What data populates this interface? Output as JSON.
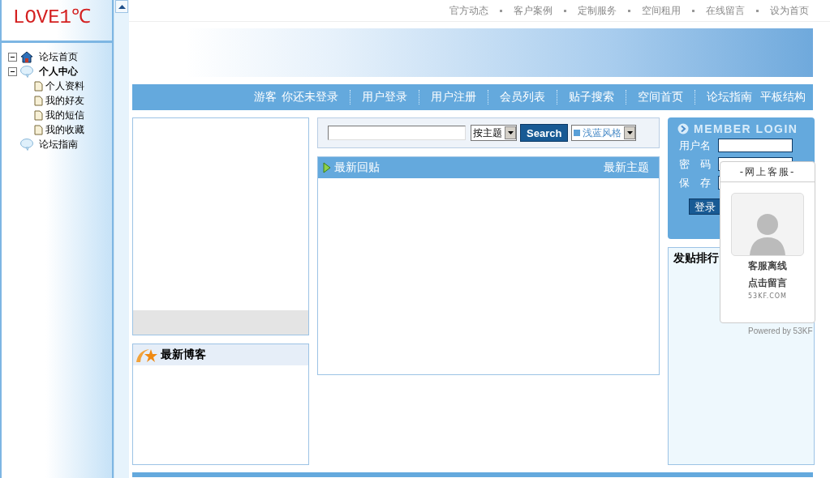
{
  "sidebar": {
    "logo": "LOVE1℃",
    "tree": [
      {
        "label": "论坛首页",
        "kind": "house",
        "bold": false,
        "expanded": true
      },
      {
        "label": "个人中心",
        "kind": "bubble",
        "bold": true,
        "expanded": true,
        "children": [
          {
            "label": "个人资料",
            "kind": "page",
            "bold": false
          },
          {
            "label": "我的好友",
            "kind": "page",
            "bold": false
          },
          {
            "label": "我的短信",
            "kind": "page",
            "bold": false
          },
          {
            "label": "我的收藏",
            "kind": "page",
            "bold": false
          }
        ]
      },
      {
        "label": "论坛指南",
        "kind": "bubble",
        "bold": false
      }
    ]
  },
  "top_links": [
    "官方动态",
    "客户案例",
    "定制服务",
    "空间租用",
    "在线留言",
    "设为首页"
  ],
  "nav": {
    "guest": "游客",
    "status": "你还未登录",
    "links": [
      {
        "label": "用户登录",
        "divider_before": true
      },
      {
        "label": "用户注册",
        "divider_before": true
      },
      {
        "label": "会员列表",
        "divider_before": true
      },
      {
        "label": "贴子搜索",
        "divider_before": true
      },
      {
        "label": "空间首页",
        "divider_before": true
      },
      {
        "label": "论坛指南",
        "divider_before": true
      },
      {
        "label": "平板结构",
        "divider_before": false
      }
    ]
  },
  "search": {
    "scope": "按主题",
    "button": "Search",
    "style": "浅蓝风格"
  },
  "replies_panel": {
    "title": "最新回贴",
    "link": "最新主题"
  },
  "blogs_panel": {
    "title": "最新博客"
  },
  "login": {
    "title": "MEMBER LOGIN",
    "username_label": "用户名",
    "password_label": "密　码",
    "remember_label": "保　存",
    "button": "登录"
  },
  "rank_panel": {
    "title": "发贴排行"
  },
  "support_widget": {
    "title": "-网上客服-",
    "status": "客服离线",
    "action": "点击留言",
    "brand": "53KF.COM",
    "powered": "Powered by 53KF"
  }
}
